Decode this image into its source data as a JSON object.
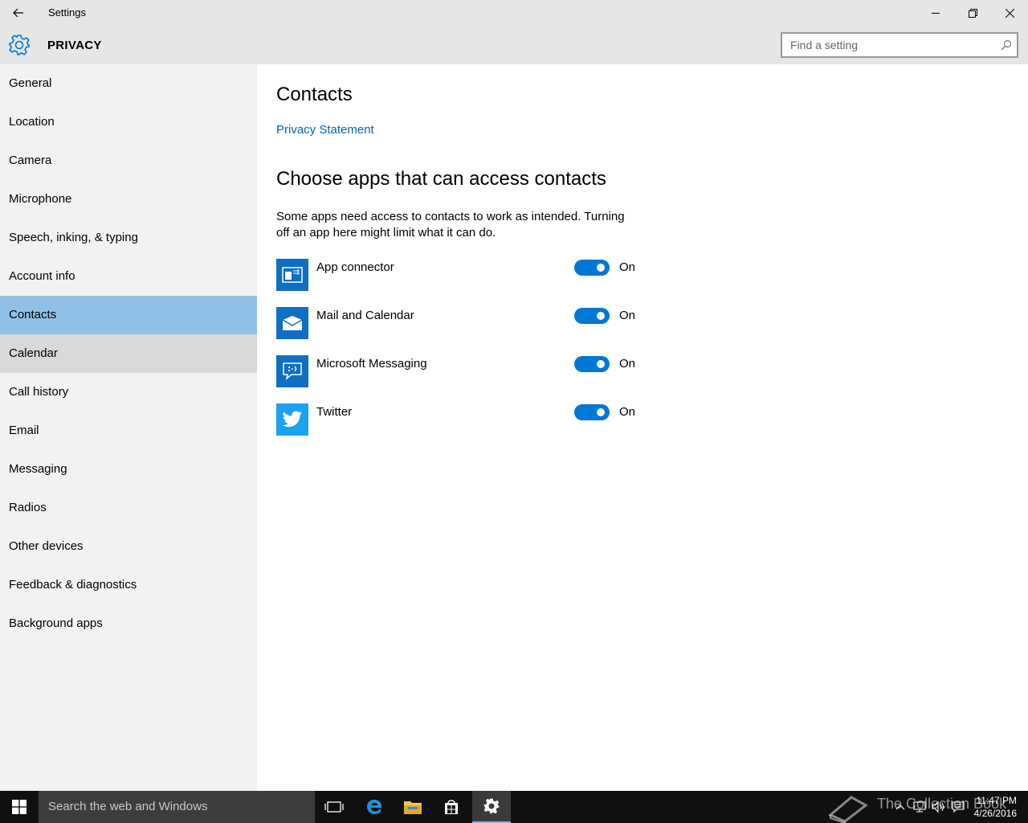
{
  "window": {
    "title": "Settings",
    "back_icon": "arrow-left-icon",
    "minimize_icon": "minimize-icon",
    "restore_icon": "restore-icon",
    "close_icon": "close-icon"
  },
  "header": {
    "icon": "gear-icon",
    "title": "PRIVACY",
    "search_placeholder": "Find a setting",
    "search_icon": "search-icon"
  },
  "sidebar": {
    "items": [
      {
        "label": "General"
      },
      {
        "label": "Location"
      },
      {
        "label": "Camera"
      },
      {
        "label": "Microphone"
      },
      {
        "label": "Speech, inking, & typing"
      },
      {
        "label": "Account info"
      },
      {
        "label": "Contacts",
        "state": "selected"
      },
      {
        "label": "Calendar",
        "state": "hover"
      },
      {
        "label": "Call history"
      },
      {
        "label": "Email"
      },
      {
        "label": "Messaging"
      },
      {
        "label": "Radios"
      },
      {
        "label": "Other devices"
      },
      {
        "label": "Feedback & diagnostics"
      },
      {
        "label": "Background apps"
      }
    ]
  },
  "main": {
    "title": "Contacts",
    "privacy_link": "Privacy Statement",
    "section_title": "Choose apps that can access contacts",
    "description": "Some apps need access to contacts to work as intended. Turning off an app here might limit what it can do.",
    "apps": [
      {
        "name": "App connector",
        "icon": "app-connector-icon",
        "toggle": "On",
        "enabled": true
      },
      {
        "name": "Mail and Calendar",
        "icon": "mail-icon",
        "toggle": "On",
        "enabled": true
      },
      {
        "name": "Microsoft Messaging",
        "icon": "messaging-icon",
        "toggle": "On",
        "enabled": true
      },
      {
        "name": "Twitter",
        "icon": "twitter-icon",
        "toggle": "On",
        "enabled": true
      }
    ]
  },
  "taskbar": {
    "start_icon": "windows-logo-icon",
    "search_placeholder": "Search the web and Windows",
    "apps": [
      "task-view-icon",
      "edge-icon",
      "file-explorer-icon",
      "store-icon",
      "settings-gear-icon"
    ],
    "time": "11:47 PM",
    "date": "4/26/2016",
    "watermark": "The Collection Book"
  },
  "colors": {
    "accent": "#0078d7",
    "link": "#0067b8",
    "selected_nav": "#90c0e6",
    "hover_nav": "#d9d9d9",
    "sidebar_bg": "#f2f2f2",
    "titlebar_bg": "#e6e6e6",
    "taskbar_bg": "#101010"
  }
}
